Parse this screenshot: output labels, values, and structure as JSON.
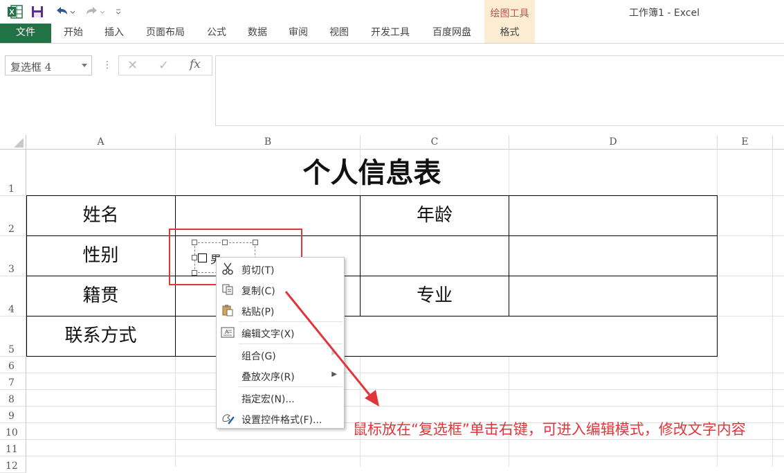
{
  "title_bar": {
    "doc_title": "工作簿1 - Excel",
    "contextual_group": "绘图工具",
    "contextual_tab": "格式"
  },
  "ribbon": {
    "file_tab": "文件",
    "tabs": [
      "开始",
      "插入",
      "页面布局",
      "公式",
      "数据",
      "审阅",
      "视图",
      "开发工具",
      "百度网盘"
    ]
  },
  "formula_bar": {
    "name_box": "复选框 4",
    "formula_value": ""
  },
  "sheet": {
    "columns": [
      "A",
      "B",
      "C",
      "D",
      "E"
    ],
    "rows": [
      "1",
      "2",
      "3",
      "4",
      "5",
      "6",
      "7",
      "8",
      "9",
      "10",
      "11",
      "12"
    ],
    "title_cell": "个人信息表",
    "cells": {
      "a2": "姓名",
      "a3": "性别",
      "a4": "籍贯",
      "a5": "联系方式",
      "c2": "年龄",
      "c4": "专业"
    },
    "checkbox_label": "男"
  },
  "context_menu": {
    "items": [
      {
        "label": "剪切(T)",
        "icon": "scissors-icon"
      },
      {
        "label": "复制(C)",
        "icon": "copy-icon"
      },
      {
        "label": "粘贴(P)",
        "icon": "paste-icon"
      },
      {
        "label": "编辑文字(X)",
        "icon": "edit-text-icon"
      },
      {
        "label": "组合(G)",
        "icon": ""
      },
      {
        "label": "叠放次序(R)",
        "icon": ""
      },
      {
        "label": "指定宏(N)...",
        "icon": ""
      },
      {
        "label": "设置控件格式(F)...",
        "icon": "format-control-icon"
      }
    ]
  },
  "annotation": "鼠标放在“复选框”单击右键，可进入编辑模式，修改文字内容",
  "colors": {
    "excel_green": "#217346",
    "annotation_red": "#e0363a",
    "contextual_tab_bg": "#fbecd2",
    "contextual_tab_text": "#c0504d"
  }
}
